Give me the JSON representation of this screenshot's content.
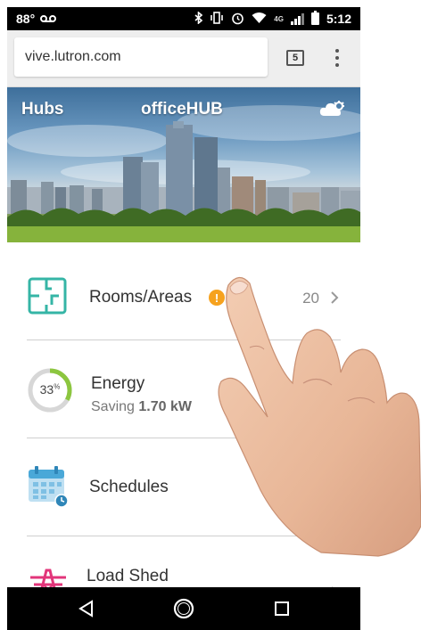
{
  "status_bar": {
    "left_text": "88°",
    "voicemail_icon": "voicemail-icon",
    "network": "4G",
    "time": "5:12"
  },
  "browser": {
    "url": "vive.lutron.com",
    "tab_count": "5"
  },
  "hero": {
    "back_label": "Hubs",
    "title": "officeHUB"
  },
  "menu": [
    {
      "label": "Rooms/Areas",
      "count": "20",
      "alert": "!",
      "icon": "floorplan-icon"
    },
    {
      "label": "Energy",
      "gauge_value": "33",
      "gauge_unit": "%",
      "gauge_fraction": 0.33,
      "sub_prefix": "Saving",
      "sub_value": "1.70 kW",
      "icon": "energy-gauge-icon"
    },
    {
      "label": "Schedules",
      "icon": "calendar-icon"
    },
    {
      "label": "Load Shed",
      "icon": "power-tower-icon"
    }
  ],
  "colors": {
    "accent_teal": "#35b5a6",
    "gauge_green": "#8cc63f",
    "alert_orange": "#f6a21e",
    "loadshed_pink": "#e2357a",
    "calendar_blue": "#4aa8d8"
  }
}
